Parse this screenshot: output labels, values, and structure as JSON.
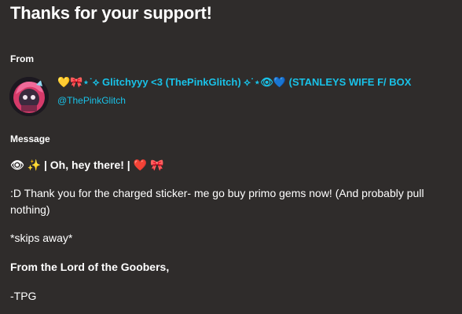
{
  "page": {
    "title": "Thanks for your support!"
  },
  "from": {
    "label": "From",
    "sender_name": "💛🎀⋆˙⟡ Glitchyyy <3 (ThePinkGlitch) ⟡˙⋆👁💙 (STANLEYS WIFE F/ BOX",
    "sender_handle": "@ThePinkGlitch"
  },
  "message": {
    "label": "Message",
    "header": "👁 ✨ | Oh, hey there! | ❤️ 🎀",
    "body": ":D Thank you for the charged sticker- me go buy primo gems now! (And probably pull nothing)",
    "action": "*skips away*",
    "signoff": "From the Lord of the Goobers,",
    "signature": "-TPG"
  },
  "colors": {
    "background": "#2f2c2b",
    "text": "#ffffff",
    "accent": "#19c2e8"
  }
}
